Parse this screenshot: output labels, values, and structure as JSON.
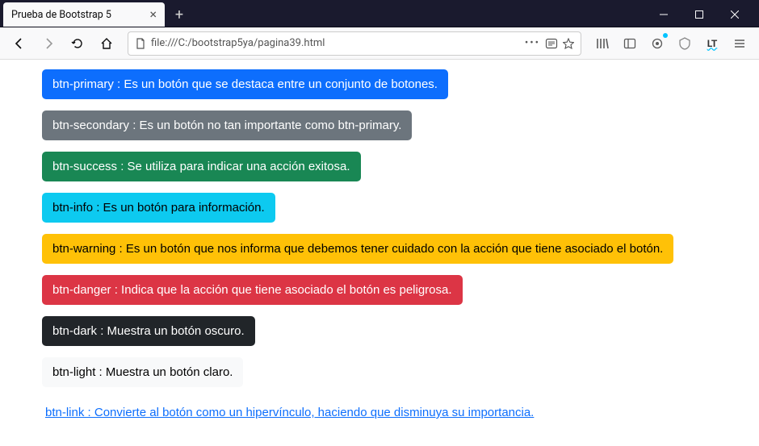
{
  "tab": {
    "title": "Prueba de Bootstrap 5"
  },
  "url": "file:///C:/bootstrap5ya/pagina39.html",
  "buttons": {
    "primary": "btn-primary : Es un botón que se destaca entre un conjunto de botones.",
    "secondary": "btn-secondary : Es un botón no tan importante como btn-primary.",
    "success": "btn-success : Se utiliza para indicar una acción exitosa.",
    "info": "btn-info : Es un botón para información.",
    "warning": "btn-warning : Es un botón que nos informa que debemos tener cuidado con la acción que tiene asociado el botón.",
    "danger": "btn-danger : Indica que la acción que tiene asociado el botón es peligrosa.",
    "dark": "btn-dark : Muestra un botón oscuro.",
    "light": "btn-light : Muestra un botón claro.",
    "link": "btn-link : Convierte al botón como un hipervínculo, haciendo que disminuya su importancia."
  }
}
